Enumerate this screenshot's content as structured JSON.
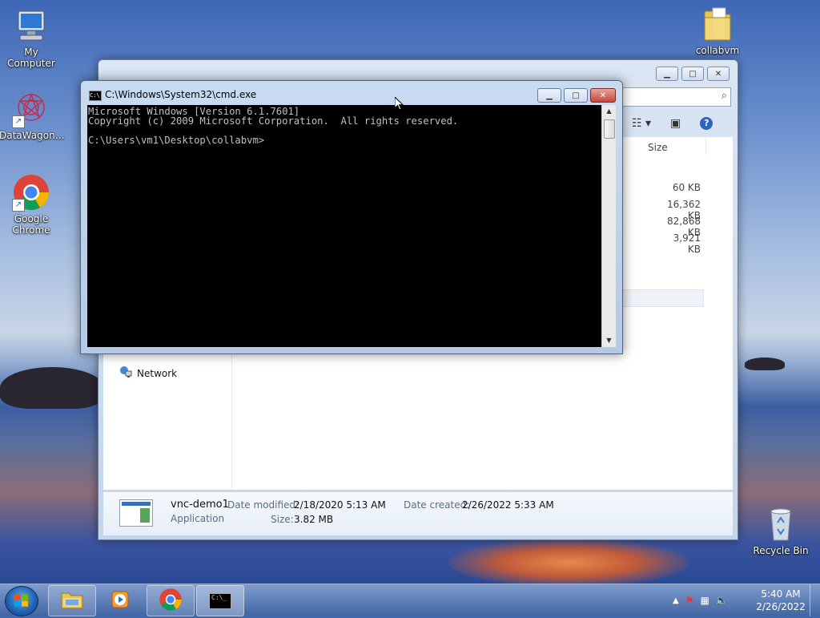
{
  "desktop": {
    "icons": [
      {
        "label": "My Computer",
        "icon": "computer-icon"
      },
      {
        "label": "DataWagon…",
        "icon": "datawagon-icon"
      },
      {
        "label": "Google Chrome",
        "icon": "chrome-icon"
      },
      {
        "label": "collabvm",
        "icon": "folder-icon"
      },
      {
        "label": "Recycle Bin",
        "icon": "recycle-bin-icon"
      }
    ]
  },
  "explorer": {
    "size_header": "Size",
    "sizes": [
      "60 KB",
      "16,362 KB",
      "82,868 KB",
      "3,921 KB"
    ],
    "nav_network": "Network",
    "details": {
      "name": "vnc-demo1",
      "type": "Application",
      "modified_label": "Date modified:",
      "modified_value": "2/18/2020 5:13 AM",
      "size_label": "Size:",
      "size_value": "3.82 MB",
      "created_label": "Date created:",
      "created_value": "2/26/2022 5:33 AM"
    }
  },
  "cmd": {
    "title": "C:\\Windows\\System32\\cmd.exe",
    "lines": [
      "Microsoft Windows [Version 6.1.7601]",
      "Copyright (c) 2009 Microsoft Corporation.  All rights reserved.",
      "",
      "C:\\Users\\vm1\\Desktop\\collabvm>"
    ]
  },
  "taskbar": {
    "apps": [
      "windows-explorer-icon",
      "media-player-icon",
      "chrome-icon",
      "cmd-icon"
    ],
    "time": "5:40 AM",
    "date": "2/26/2022"
  }
}
